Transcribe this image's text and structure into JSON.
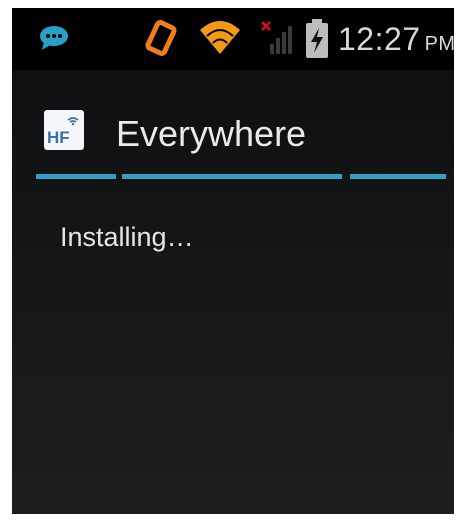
{
  "status_bar": {
    "time": "12:27",
    "ampm": "PM",
    "icons": [
      "chat-bubble-icon",
      "screen-rotation-icon",
      "wifi-icon",
      "cell-signal-no-service-icon",
      "battery-charging-icon"
    ]
  },
  "app": {
    "title": "Everywhere",
    "icon_label": "HF",
    "icon_name": "hf-app-icon"
  },
  "install": {
    "status_text": "Installing…",
    "progress_state": "indeterminate",
    "accent_color": "#2f9fc4"
  }
}
